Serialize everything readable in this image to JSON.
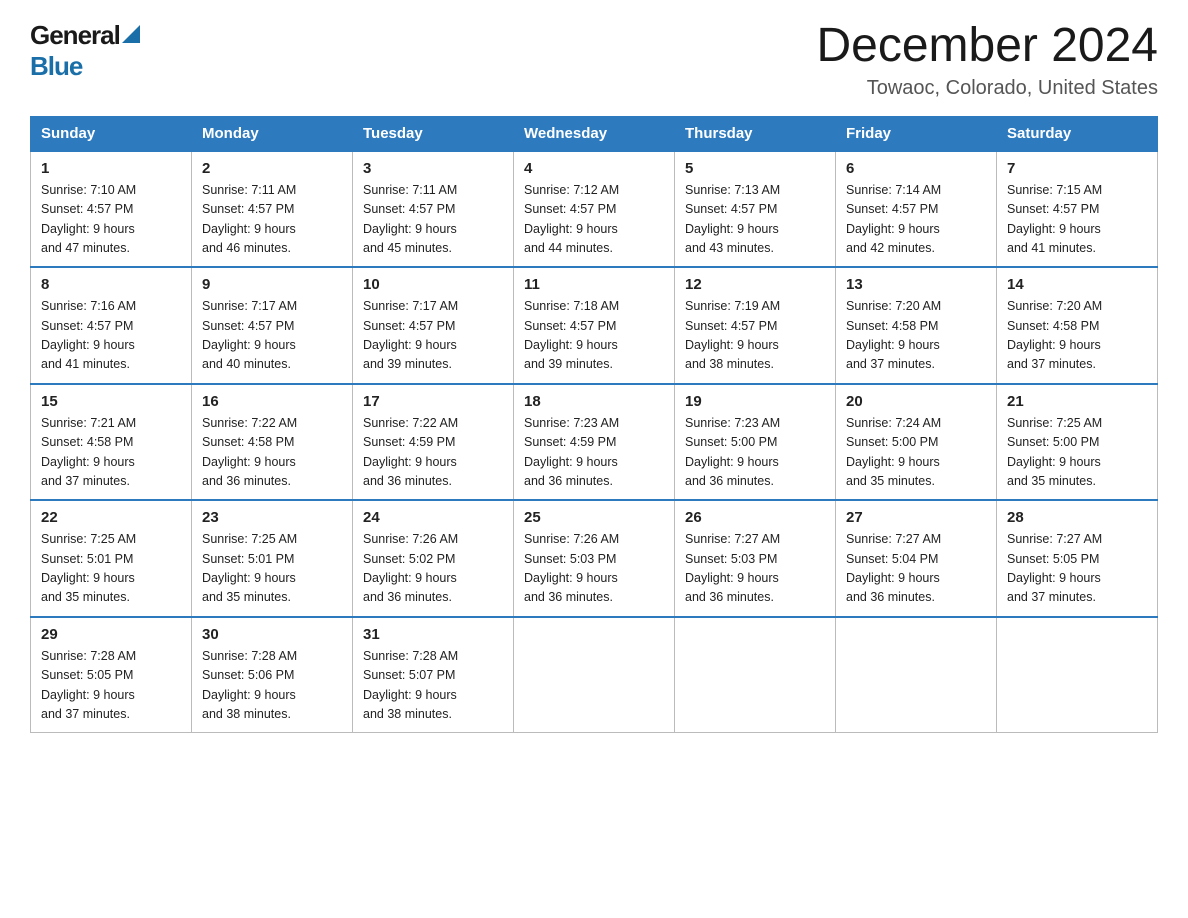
{
  "header": {
    "logo_line1": "General",
    "logo_line2": "Blue",
    "month_title": "December 2024",
    "location": "Towaoc, Colorado, United States"
  },
  "weekdays": [
    "Sunday",
    "Monday",
    "Tuesday",
    "Wednesday",
    "Thursday",
    "Friday",
    "Saturday"
  ],
  "weeks": [
    [
      {
        "day": "1",
        "sunrise": "7:10 AM",
        "sunset": "4:57 PM",
        "daylight": "9 hours and 47 minutes."
      },
      {
        "day": "2",
        "sunrise": "7:11 AM",
        "sunset": "4:57 PM",
        "daylight": "9 hours and 46 minutes."
      },
      {
        "day": "3",
        "sunrise": "7:11 AM",
        "sunset": "4:57 PM",
        "daylight": "9 hours and 45 minutes."
      },
      {
        "day": "4",
        "sunrise": "7:12 AM",
        "sunset": "4:57 PM",
        "daylight": "9 hours and 44 minutes."
      },
      {
        "day": "5",
        "sunrise": "7:13 AM",
        "sunset": "4:57 PM",
        "daylight": "9 hours and 43 minutes."
      },
      {
        "day": "6",
        "sunrise": "7:14 AM",
        "sunset": "4:57 PM",
        "daylight": "9 hours and 42 minutes."
      },
      {
        "day": "7",
        "sunrise": "7:15 AM",
        "sunset": "4:57 PM",
        "daylight": "9 hours and 41 minutes."
      }
    ],
    [
      {
        "day": "8",
        "sunrise": "7:16 AM",
        "sunset": "4:57 PM",
        "daylight": "9 hours and 41 minutes."
      },
      {
        "day": "9",
        "sunrise": "7:17 AM",
        "sunset": "4:57 PM",
        "daylight": "9 hours and 40 minutes."
      },
      {
        "day": "10",
        "sunrise": "7:17 AM",
        "sunset": "4:57 PM",
        "daylight": "9 hours and 39 minutes."
      },
      {
        "day": "11",
        "sunrise": "7:18 AM",
        "sunset": "4:57 PM",
        "daylight": "9 hours and 39 minutes."
      },
      {
        "day": "12",
        "sunrise": "7:19 AM",
        "sunset": "4:57 PM",
        "daylight": "9 hours and 38 minutes."
      },
      {
        "day": "13",
        "sunrise": "7:20 AM",
        "sunset": "4:58 PM",
        "daylight": "9 hours and 37 minutes."
      },
      {
        "day": "14",
        "sunrise": "7:20 AM",
        "sunset": "4:58 PM",
        "daylight": "9 hours and 37 minutes."
      }
    ],
    [
      {
        "day": "15",
        "sunrise": "7:21 AM",
        "sunset": "4:58 PM",
        "daylight": "9 hours and 37 minutes."
      },
      {
        "day": "16",
        "sunrise": "7:22 AM",
        "sunset": "4:58 PM",
        "daylight": "9 hours and 36 minutes."
      },
      {
        "day": "17",
        "sunrise": "7:22 AM",
        "sunset": "4:59 PM",
        "daylight": "9 hours and 36 minutes."
      },
      {
        "day": "18",
        "sunrise": "7:23 AM",
        "sunset": "4:59 PM",
        "daylight": "9 hours and 36 minutes."
      },
      {
        "day": "19",
        "sunrise": "7:23 AM",
        "sunset": "5:00 PM",
        "daylight": "9 hours and 36 minutes."
      },
      {
        "day": "20",
        "sunrise": "7:24 AM",
        "sunset": "5:00 PM",
        "daylight": "9 hours and 35 minutes."
      },
      {
        "day": "21",
        "sunrise": "7:25 AM",
        "sunset": "5:00 PM",
        "daylight": "9 hours and 35 minutes."
      }
    ],
    [
      {
        "day": "22",
        "sunrise": "7:25 AM",
        "sunset": "5:01 PM",
        "daylight": "9 hours and 35 minutes."
      },
      {
        "day": "23",
        "sunrise": "7:25 AM",
        "sunset": "5:01 PM",
        "daylight": "9 hours and 35 minutes."
      },
      {
        "day": "24",
        "sunrise": "7:26 AM",
        "sunset": "5:02 PM",
        "daylight": "9 hours and 36 minutes."
      },
      {
        "day": "25",
        "sunrise": "7:26 AM",
        "sunset": "5:03 PM",
        "daylight": "9 hours and 36 minutes."
      },
      {
        "day": "26",
        "sunrise": "7:27 AM",
        "sunset": "5:03 PM",
        "daylight": "9 hours and 36 minutes."
      },
      {
        "day": "27",
        "sunrise": "7:27 AM",
        "sunset": "5:04 PM",
        "daylight": "9 hours and 36 minutes."
      },
      {
        "day": "28",
        "sunrise": "7:27 AM",
        "sunset": "5:05 PM",
        "daylight": "9 hours and 37 minutes."
      }
    ],
    [
      {
        "day": "29",
        "sunrise": "7:28 AM",
        "sunset": "5:05 PM",
        "daylight": "9 hours and 37 minutes."
      },
      {
        "day": "30",
        "sunrise": "7:28 AM",
        "sunset": "5:06 PM",
        "daylight": "9 hours and 38 minutes."
      },
      {
        "day": "31",
        "sunrise": "7:28 AM",
        "sunset": "5:07 PM",
        "daylight": "9 hours and 38 minutes."
      },
      null,
      null,
      null,
      null
    ]
  ],
  "labels": {
    "sunrise_prefix": "Sunrise: ",
    "sunset_prefix": "Sunset: ",
    "daylight_prefix": "Daylight: "
  }
}
